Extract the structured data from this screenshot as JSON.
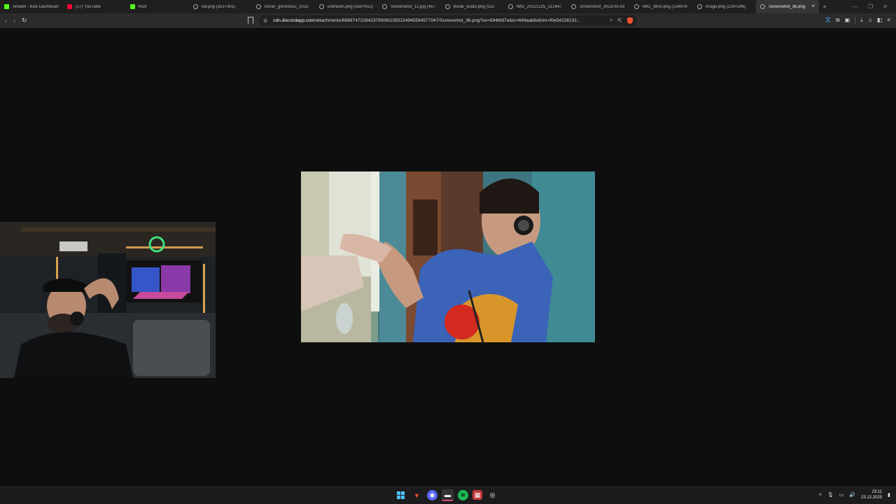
{
  "browser": {
    "tabs": [
      {
        "label": "Stream - Kick Dashboard",
        "icon": "kick-icon",
        "active": false
      },
      {
        "label": "(27) YouTube",
        "icon": "youtube-icon",
        "active": false
      },
      {
        "label": "Kick",
        "icon": "kick-icon",
        "active": false
      },
      {
        "label": "uw.png (351×301)",
        "icon": "globe-icon",
        "active": false
      },
      {
        "label": "Ekran_goruntusu_2022-",
        "icon": "globe-icon",
        "active": false
      },
      {
        "label": "unknown.png (555×912)",
        "icon": "globe-icon",
        "active": false
      },
      {
        "label": "Screenshot_12.jpg (457",
        "icon": "globe-icon",
        "active": false
      },
      {
        "label": "burak_kudur.png (512",
        "icon": "globe-icon",
        "active": false
      },
      {
        "label": "IMG_20221225_212647",
        "icon": "globe-icon",
        "active": false
      },
      {
        "label": "Screenshot_2023-05-03",
        "icon": "globe-icon",
        "active": false
      },
      {
        "label": "IMG_3800.png (1346×9",
        "icon": "globe-icon",
        "active": false
      },
      {
        "label": "image.png (229×246)",
        "icon": "globe-icon",
        "active": false
      },
      {
        "label": "Screenshot_36.png",
        "icon": "globe-icon",
        "active": true
      }
    ],
    "new_tab": "+",
    "url": "cdn.discordapp.com/attachments/688874722842378306/1055134945594577047/Screenshot_36.png?ex=694bfd7e&is=694aabfe&hm=f0e54228132...",
    "url_domain": "cdn.discordapp.com",
    "url_path": "/attachments/688874722842378306/1055134945594577047/Screenshot_36.png?ex=694bfd7e&is=694aabfe&hm=f0e54228132..."
  },
  "taskbar": {
    "apps": [
      "windows-start-icon",
      "brave-browser-icon",
      "discord-icon",
      "terminal-icon",
      "spotify-icon",
      "calendar-app-icon",
      "obs-icon"
    ],
    "time": "23:11",
    "date": "23.12.2025"
  },
  "colors": {
    "accent_active_tab": "#363636",
    "kick_green": "#53fc18",
    "youtube_red": "#ff0033",
    "brave_orange": "#f0542f"
  }
}
